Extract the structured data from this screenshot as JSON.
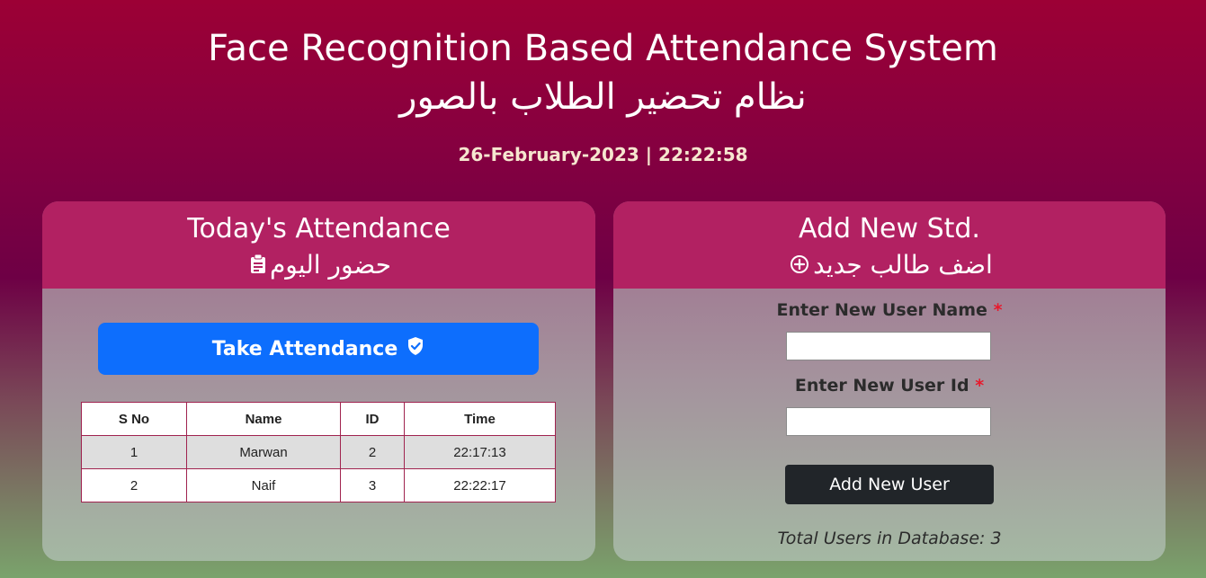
{
  "header": {
    "title_en": "Face Recognition Based Attendance System",
    "title_ar": "نظام تحضير الطلاب بالصور",
    "datetime": "26-February-2023 | 22:22:58"
  },
  "attendance_card": {
    "title_en": "Today's Attendance",
    "title_ar": "حضور اليوم",
    "title_icon": "clipboard-icon",
    "button_label": "Take Attendance",
    "button_icon": "shield-check-icon",
    "table": {
      "columns": [
        "S No",
        "Name",
        "ID",
        "Time"
      ],
      "rows": [
        [
          "1",
          "Marwan",
          "2",
          "22:17:13"
        ],
        [
          "2",
          "Naif",
          "3",
          "22:22:17"
        ]
      ]
    }
  },
  "add_card": {
    "title_en": "Add New Std.",
    "title_ar": "اضف طالب جديد",
    "title_icon": "plus-circle-icon",
    "name_label": "Enter New User Name",
    "id_label": "Enter New User Id",
    "required_mark": "*",
    "name_value": "",
    "id_value": "",
    "button_label": "Add New User",
    "total_text": "Total Users in Database: 3"
  },
  "colors": {
    "card_header": "#b22162",
    "primary_button": "#0d6efd",
    "dark_button": "#212529",
    "required": "#e8192c"
  }
}
